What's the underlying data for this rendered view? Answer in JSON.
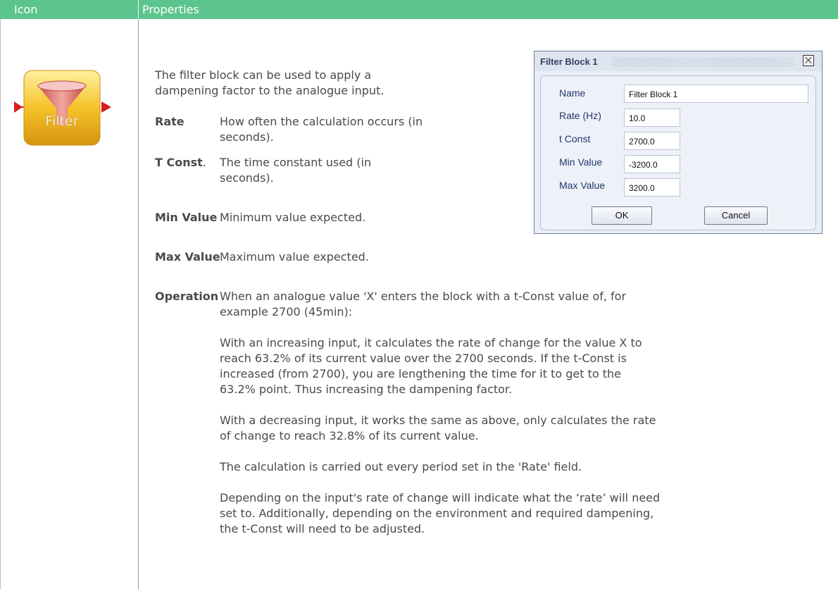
{
  "header": {
    "icon_col": "Icon",
    "properties_col": "Properties"
  },
  "icon": {
    "label": "Filter"
  },
  "intro": [
    "The filter block can be used to apply a",
    "dampening factor to the analogue input."
  ],
  "rate": {
    "label": "Rate",
    "lines": [
      "How often the calculation occurs (in",
      "seconds)."
    ]
  },
  "tconst": {
    "label": "T Const",
    "dot": ".",
    "lines": [
      "The time constant used (in",
      "seconds)."
    ]
  },
  "min": {
    "label": "Min Value",
    "desc": "Minimum value expected."
  },
  "max": {
    "label": "Max Value",
    "desc": "Maximum value expected."
  },
  "operation": {
    "label": "Operation",
    "lines": [
      "When an analogue value 'X' enters the block with a t-Const value of, for",
      "example 2700 (45min):"
    ],
    "p1": [
      "With an increasing input, it calculates the rate of change for the value X to",
      "reach 63.2% of its current value over the 2700 seconds. If the t-Const is",
      "increased (from 2700), you are lengthening the time for it to get to the",
      "63.2% point. Thus increasing the dampening factor."
    ],
    "p2": [
      "With a decreasing input, it works the same as above, only calculates the rate",
      "of change to reach 32.8% of its current value."
    ],
    "p3": [
      "The calculation is carried out every period set in the 'Rate' field."
    ],
    "p4": [
      "Depending on the input's rate of change will indicate what the ‘rate’ will need",
      "set to. Additionally, depending on the environment and required dampening,",
      "the t-Const will need to be adjusted."
    ]
  },
  "dialog": {
    "title": "Filter Block 1",
    "fields": {
      "name": {
        "label": "Name",
        "value": "Filter Block 1"
      },
      "rate": {
        "label": "Rate (Hz)",
        "value": "10.0"
      },
      "tconst": {
        "label": "t Const",
        "value": "2700.0"
      },
      "min": {
        "label": "Min Value",
        "value": "-3200.0"
      },
      "max": {
        "label": "Max Value",
        "value": "3200.0"
      }
    },
    "ok": "OK",
    "cancel": "Cancel"
  },
  "colors": {
    "header_bg": "#5cc58e",
    "text": "#4a4a4a",
    "dialog_label": "#23356b"
  }
}
